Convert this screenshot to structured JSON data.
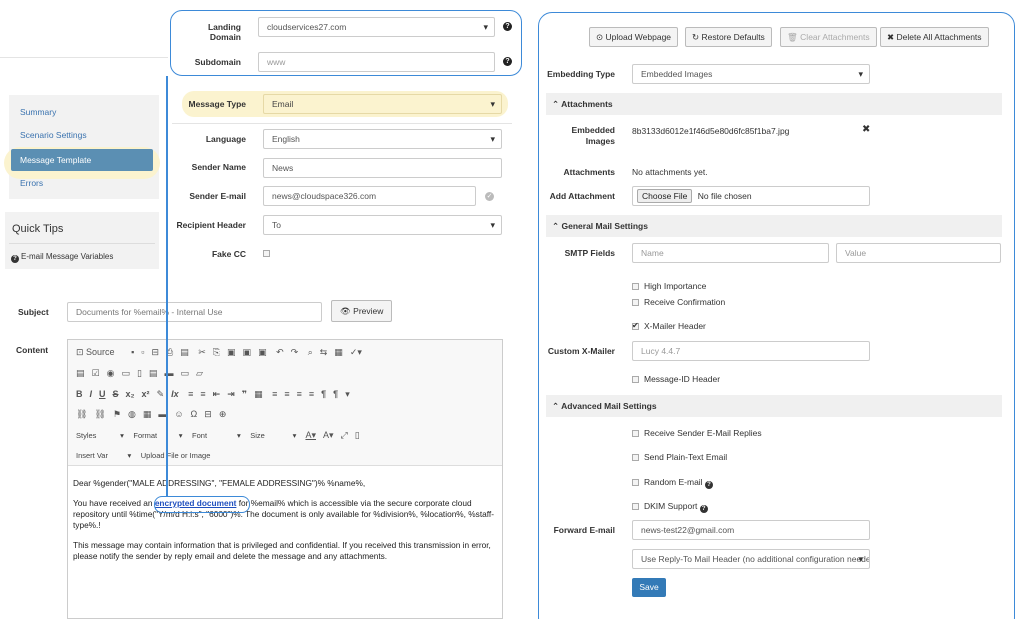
{
  "sidebar": {
    "items": [
      {
        "label": "Summary"
      },
      {
        "label": "Scenario Settings"
      },
      {
        "label": "Message Template"
      },
      {
        "label": "Errors"
      }
    ]
  },
  "quick_tips": {
    "title": "Quick Tips",
    "link": "E-mail Message Variables"
  },
  "domain": {
    "landing_label": "Landing Domain",
    "landing_value": "cloudservices27.com",
    "subdomain_label": "Subdomain",
    "subdomain_value": "www"
  },
  "message": {
    "type_label": "Message Type",
    "type_value": "Email",
    "language_label": "Language",
    "language_value": "English",
    "sender_name_label": "Sender Name",
    "sender_name_value": "News",
    "sender_email_label": "Sender E-mail",
    "sender_email_value": "news@cloudspace326.com",
    "recipient_header_label": "Recipient Header",
    "recipient_header_value": "To",
    "fake_cc_label": "Fake CC"
  },
  "subject": {
    "label": "Subject",
    "value": "Documents  for %email% - Internal Use",
    "preview_label": "Preview"
  },
  "content": {
    "label": "Content",
    "toolbar": {
      "source": "Source",
      "styles": "Styles",
      "format": "Format",
      "font": "Font",
      "size": "Size",
      "insert_var": "Insert Var",
      "upload": "Upload File or Image"
    },
    "body": {
      "line1": "Dear %gender(\"MALE ADDRESSING\", \"FEMALE ADDRESSING\")%  %name%,",
      "p2_before": "You have received an ",
      "p2_link": "encrypted document",
      "p2_after": " for %email% which is accessible via the secure corporate cloud repository until  %time(\"Y/m/d H:i:s\", \"6000\")%. The document is only available for %division%, %location%, %staff-type%.!",
      "p3": "This message may contain information that is privileged and confidential. If you received this transmission in error, please notify the sender by reply email and delete the message and any attachments."
    }
  },
  "right": {
    "buttons": {
      "upload": "Upload Webpage",
      "restore": "Restore Defaults",
      "clear": "Clear Attachments",
      "delete": "Delete All Attachments"
    },
    "embedding_label": "Embedding Type",
    "embedding_value": "Embedded Images",
    "attachments_section": "Attachments",
    "embedded_images_label": "Embedded Images",
    "embedded_image_file": "8b3133d6012e1f46d5e80d6fc85f1ba7.jpg",
    "attachments_label": "Attachments",
    "attachments_value": "No attachments yet.",
    "add_attachment_label": "Add Attachment",
    "choose_file": "Choose File",
    "no_file": "No file chosen",
    "general_section": "General Mail Settings",
    "smtp_label": "SMTP Fields",
    "smtp_name_ph": "Name",
    "smtp_value_ph": "Value",
    "high_importance": "High Importance",
    "receive_confirmation": "Receive Confirmation",
    "x_mailer_header": "X-Mailer Header",
    "custom_x_mailer_label": "Custom X-Mailer",
    "custom_x_mailer_ph": "Lucy 4.4.7",
    "message_id_header": "Message-ID Header",
    "advanced_section": "Advanced Mail Settings",
    "receive_replies": "Receive Sender E-Mail Replies",
    "plain_text": "Send Plain-Text Email",
    "random_email": "Random E-mail",
    "dkim": "DKIM Support",
    "forward_label": "Forward E-mail",
    "forward_value": "news-test22@gmail.com",
    "reply_to_value": "Use Reply-To Mail Header (no additional configuration needed)",
    "save": "Save"
  },
  "colors": {
    "annotation_blue": "#3d8ad8",
    "highlight_yellow": "#fbf3cf",
    "active_nav": "#5b8fb3",
    "primary": "#337ab7"
  }
}
